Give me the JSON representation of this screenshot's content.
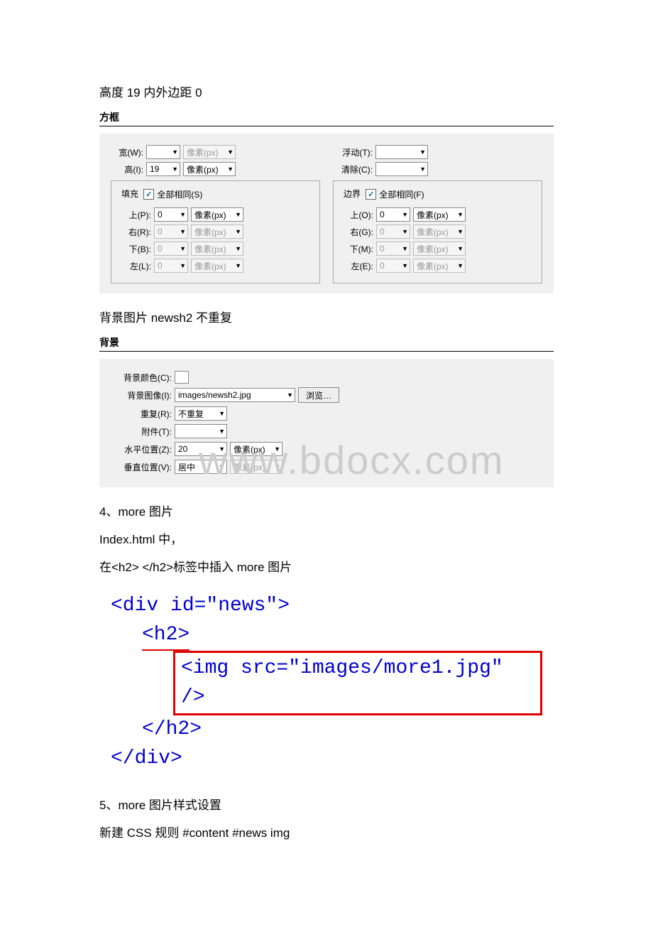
{
  "heading1": "高度 19 内外边距 0",
  "box_panel": {
    "title": "方框",
    "width_label": "宽(W):",
    "width_value": "",
    "width_unit": "像素(px)",
    "height_label": "高(I):",
    "height_value": "19",
    "height_unit": "像素(px)",
    "float_label": "浮动(T):",
    "float_value": "",
    "clear_label": "清除(C):",
    "clear_value": "",
    "padding_legend": "填充",
    "margin_legend": "边界",
    "same_all_s": "全部相同(S)",
    "same_all_f": "全部相同(F)",
    "top_p_label": "上(P):",
    "top_p_val": "0",
    "right_r_label": "右(R):",
    "right_r_val": "0",
    "bottom_b_label": "下(B):",
    "bottom_b_val": "0",
    "left_l_label": "左(L):",
    "left_l_val": "0",
    "top_o_label": "上(O):",
    "top_o_val": "0",
    "right_g_label": "右(G):",
    "right_g_val": "0",
    "bottom_m_label": "下(M):",
    "bottom_m_val": "0",
    "left_e_label": "左(E):",
    "left_e_val": "0",
    "unit_px": "像素(px)"
  },
  "heading2": "背景图片 newsh2 不重复",
  "bg_panel": {
    "title": "背景",
    "bg_color_label": "背景颜色(C):",
    "bg_image_label": "背景图像(I):",
    "bg_image_value": "images/newsh2.jpg",
    "browse_label": "浏览…",
    "repeat_label": "重复(R):",
    "repeat_value": "不重复",
    "attach_label": "附件(T):",
    "attach_value": "",
    "hpos_label": "水平位置(Z):",
    "hpos_value": "20",
    "hpos_unit": "像素(px)",
    "vpos_label": "垂直位置(V):",
    "vpos_value": "居中",
    "vpos_unit": "像素(px)"
  },
  "watermark_text": "www.bdocx.com",
  "sec4_line1": "4、more 图片",
  "sec4_line2": "Index.html 中，",
  "sec4_line3": "在<h2> </h2>标签中插入 more 图片",
  "code": {
    "l1": "<div id=\"news\">",
    "l2": "<h2>",
    "l3": "<img src=\"images/more1.jpg\" />",
    "l4": "</h2>",
    "l5": "</div>"
  },
  "sec5_line1": "5、more 图片样式设置",
  "sec5_line2": "新建 CSS 规则  #content #news img"
}
